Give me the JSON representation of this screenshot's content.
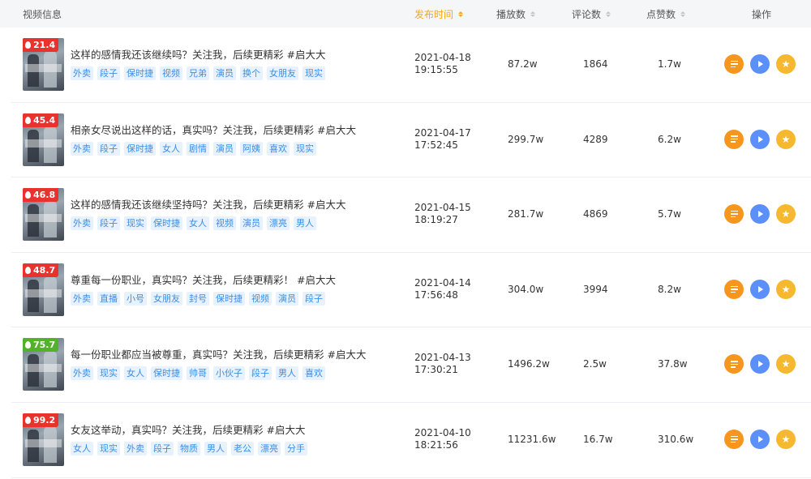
{
  "header": {
    "video_info": "视频信息",
    "publish_time": "发布时间",
    "plays": "播放数",
    "comments": "评论数",
    "likes": "点赞数",
    "actions": "操作"
  },
  "colors": {
    "accent": "#f5a623",
    "heat_red": "#e7322e",
    "heat_green": "#52b22a",
    "tag_bg": "#e8f2fe",
    "tag_text": "#3a8ee6"
  },
  "rows": [
    {
      "heat": "21.4",
      "heat_color": "#e7322e",
      "title": "这样的感情我还该继续吗？关注我，后续更精彩 #启大大",
      "tags": [
        "外卖",
        "段子",
        "保时捷",
        "视频",
        "兄弟",
        "演员",
        "换个",
        "女朋友",
        "现实"
      ],
      "date": "2021-04-18",
      "time": "19:15:55",
      "plays": "87.2w",
      "comments": "1864",
      "likes": "1.7w"
    },
    {
      "heat": "45.4",
      "heat_color": "#e7322e",
      "title": "相亲女尽说出这样的话，真实吗？关注我，后续更精彩 #启大大",
      "tags": [
        "外卖",
        "段子",
        "保时捷",
        "女人",
        "剧情",
        "演员",
        "阿姨",
        "喜欢",
        "现实"
      ],
      "date": "2021-04-17",
      "time": "17:52:45",
      "plays": "299.7w",
      "comments": "4289",
      "likes": "6.2w"
    },
    {
      "heat": "46.8",
      "heat_color": "#e7322e",
      "title": "这样的感情我还该继续坚持吗？关注我，后续更精彩 #启大大",
      "tags": [
        "外卖",
        "段子",
        "现实",
        "保时捷",
        "女人",
        "视频",
        "演员",
        "漂亮",
        "男人"
      ],
      "date": "2021-04-15",
      "time": "18:19:27",
      "plays": "281.7w",
      "comments": "4869",
      "likes": "5.7w"
    },
    {
      "heat": "48.7",
      "heat_color": "#e7322e",
      "title": "尊重每一份职业，真实吗？关注我，后续更精彩！ #启大大",
      "tags": [
        "外卖",
        "直播",
        "小号",
        "女朋友",
        "封号",
        "保时捷",
        "视频",
        "演员",
        "段子"
      ],
      "date": "2021-04-14",
      "time": "17:56:48",
      "plays": "304.0w",
      "comments": "3994",
      "likes": "8.2w"
    },
    {
      "heat": "75.7",
      "heat_color": "#52b22a",
      "title": "每一份职业都应当被尊重，真实吗？关注我，后续更精彩 #启大大",
      "tags": [
        "外卖",
        "现实",
        "女人",
        "保时捷",
        "帅哥",
        "小伙子",
        "段子",
        "男人",
        "喜欢"
      ],
      "date": "2021-04-13",
      "time": "17:30:21",
      "plays": "1496.2w",
      "comments": "2.5w",
      "likes": "37.8w"
    },
    {
      "heat": "99.2",
      "heat_color": "#e7322e",
      "title": "女友这举动，真实吗？关注我，后续更精彩 #启大大",
      "tags": [
        "女人",
        "现实",
        "外卖",
        "段子",
        "物质",
        "男人",
        "老公",
        "漂亮",
        "分手"
      ],
      "date": "2021-04-10",
      "time": "18:21:56",
      "plays": "11231.6w",
      "comments": "16.7w",
      "likes": "310.6w"
    }
  ]
}
